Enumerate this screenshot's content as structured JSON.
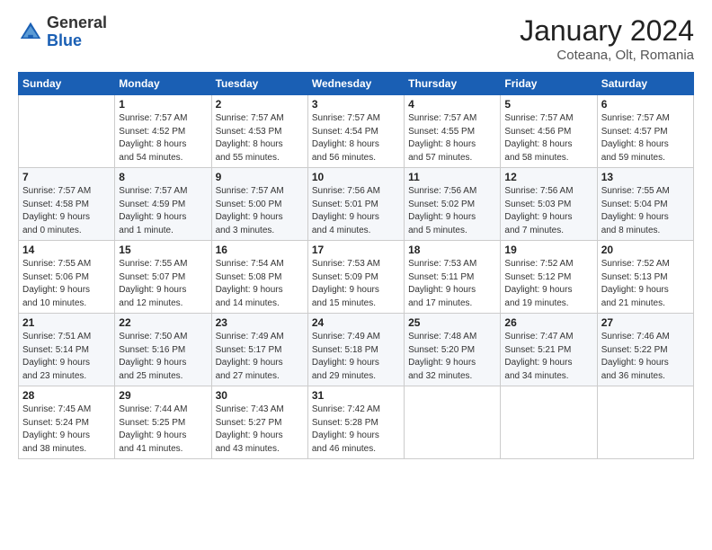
{
  "header": {
    "logo_general": "General",
    "logo_blue": "Blue",
    "title": "January 2024",
    "location": "Coteana, Olt, Romania"
  },
  "days_of_week": [
    "Sunday",
    "Monday",
    "Tuesday",
    "Wednesday",
    "Thursday",
    "Friday",
    "Saturday"
  ],
  "weeks": [
    [
      {
        "day": "",
        "info": ""
      },
      {
        "day": "1",
        "info": "Sunrise: 7:57 AM\nSunset: 4:52 PM\nDaylight: 8 hours\nand 54 minutes."
      },
      {
        "day": "2",
        "info": "Sunrise: 7:57 AM\nSunset: 4:53 PM\nDaylight: 8 hours\nand 55 minutes."
      },
      {
        "day": "3",
        "info": "Sunrise: 7:57 AM\nSunset: 4:54 PM\nDaylight: 8 hours\nand 56 minutes."
      },
      {
        "day": "4",
        "info": "Sunrise: 7:57 AM\nSunset: 4:55 PM\nDaylight: 8 hours\nand 57 minutes."
      },
      {
        "day": "5",
        "info": "Sunrise: 7:57 AM\nSunset: 4:56 PM\nDaylight: 8 hours\nand 58 minutes."
      },
      {
        "day": "6",
        "info": "Sunrise: 7:57 AM\nSunset: 4:57 PM\nDaylight: 8 hours\nand 59 minutes."
      }
    ],
    [
      {
        "day": "7",
        "info": "Sunrise: 7:57 AM\nSunset: 4:58 PM\nDaylight: 9 hours\nand 0 minutes."
      },
      {
        "day": "8",
        "info": "Sunrise: 7:57 AM\nSunset: 4:59 PM\nDaylight: 9 hours\nand 1 minute."
      },
      {
        "day": "9",
        "info": "Sunrise: 7:57 AM\nSunset: 5:00 PM\nDaylight: 9 hours\nand 3 minutes."
      },
      {
        "day": "10",
        "info": "Sunrise: 7:56 AM\nSunset: 5:01 PM\nDaylight: 9 hours\nand 4 minutes."
      },
      {
        "day": "11",
        "info": "Sunrise: 7:56 AM\nSunset: 5:02 PM\nDaylight: 9 hours\nand 5 minutes."
      },
      {
        "day": "12",
        "info": "Sunrise: 7:56 AM\nSunset: 5:03 PM\nDaylight: 9 hours\nand 7 minutes."
      },
      {
        "day": "13",
        "info": "Sunrise: 7:55 AM\nSunset: 5:04 PM\nDaylight: 9 hours\nand 8 minutes."
      }
    ],
    [
      {
        "day": "14",
        "info": "Sunrise: 7:55 AM\nSunset: 5:06 PM\nDaylight: 9 hours\nand 10 minutes."
      },
      {
        "day": "15",
        "info": "Sunrise: 7:55 AM\nSunset: 5:07 PM\nDaylight: 9 hours\nand 12 minutes."
      },
      {
        "day": "16",
        "info": "Sunrise: 7:54 AM\nSunset: 5:08 PM\nDaylight: 9 hours\nand 14 minutes."
      },
      {
        "day": "17",
        "info": "Sunrise: 7:53 AM\nSunset: 5:09 PM\nDaylight: 9 hours\nand 15 minutes."
      },
      {
        "day": "18",
        "info": "Sunrise: 7:53 AM\nSunset: 5:11 PM\nDaylight: 9 hours\nand 17 minutes."
      },
      {
        "day": "19",
        "info": "Sunrise: 7:52 AM\nSunset: 5:12 PM\nDaylight: 9 hours\nand 19 minutes."
      },
      {
        "day": "20",
        "info": "Sunrise: 7:52 AM\nSunset: 5:13 PM\nDaylight: 9 hours\nand 21 minutes."
      }
    ],
    [
      {
        "day": "21",
        "info": "Sunrise: 7:51 AM\nSunset: 5:14 PM\nDaylight: 9 hours\nand 23 minutes."
      },
      {
        "day": "22",
        "info": "Sunrise: 7:50 AM\nSunset: 5:16 PM\nDaylight: 9 hours\nand 25 minutes."
      },
      {
        "day": "23",
        "info": "Sunrise: 7:49 AM\nSunset: 5:17 PM\nDaylight: 9 hours\nand 27 minutes."
      },
      {
        "day": "24",
        "info": "Sunrise: 7:49 AM\nSunset: 5:18 PM\nDaylight: 9 hours\nand 29 minutes."
      },
      {
        "day": "25",
        "info": "Sunrise: 7:48 AM\nSunset: 5:20 PM\nDaylight: 9 hours\nand 32 minutes."
      },
      {
        "day": "26",
        "info": "Sunrise: 7:47 AM\nSunset: 5:21 PM\nDaylight: 9 hours\nand 34 minutes."
      },
      {
        "day": "27",
        "info": "Sunrise: 7:46 AM\nSunset: 5:22 PM\nDaylight: 9 hours\nand 36 minutes."
      }
    ],
    [
      {
        "day": "28",
        "info": "Sunrise: 7:45 AM\nSunset: 5:24 PM\nDaylight: 9 hours\nand 38 minutes."
      },
      {
        "day": "29",
        "info": "Sunrise: 7:44 AM\nSunset: 5:25 PM\nDaylight: 9 hours\nand 41 minutes."
      },
      {
        "day": "30",
        "info": "Sunrise: 7:43 AM\nSunset: 5:27 PM\nDaylight: 9 hours\nand 43 minutes."
      },
      {
        "day": "31",
        "info": "Sunrise: 7:42 AM\nSunset: 5:28 PM\nDaylight: 9 hours\nand 46 minutes."
      },
      {
        "day": "",
        "info": ""
      },
      {
        "day": "",
        "info": ""
      },
      {
        "day": "",
        "info": ""
      }
    ]
  ]
}
